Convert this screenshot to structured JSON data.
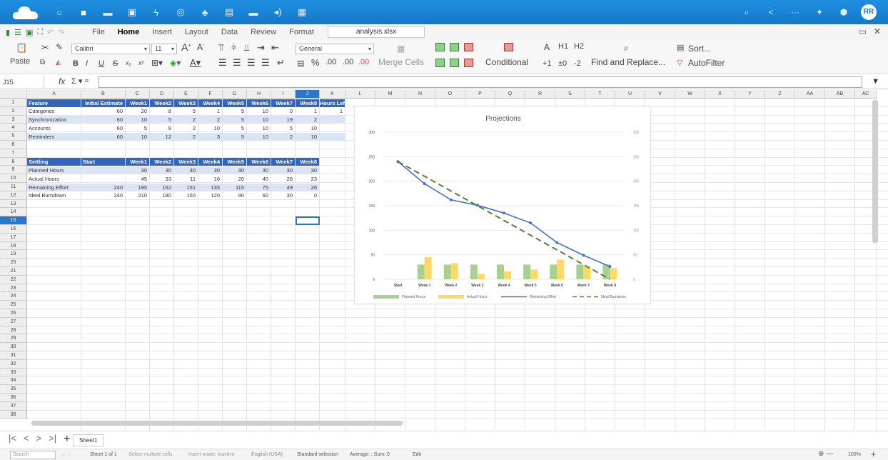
{
  "topbar": {
    "icons": [
      "circle-icon",
      "folder-icon",
      "mail-icon",
      "image-icon",
      "bolt-icon",
      "search-icon",
      "people-icon",
      "calendar-icon",
      "drive-icon",
      "audio-icon",
      "calendar2-icon"
    ],
    "icon_glyphs": [
      "○",
      "■",
      "▬",
      "▣",
      "ϟ",
      "◎",
      "♣",
      "▤",
      "▬",
      "◂)",
      "▦"
    ],
    "right_glyphs": [
      "⌕",
      "<",
      "···",
      "✦",
      "⬢"
    ],
    "avatar": "RR"
  },
  "menubar": {
    "menus": [
      "File",
      "Home",
      "Insert",
      "Layout",
      "Data",
      "Review",
      "Format"
    ],
    "active": "Home",
    "filename": "analysis.xlsx"
  },
  "ribbon": {
    "paste": "Paste",
    "font_name": "Calibri",
    "font_size": "11",
    "number_format": "General",
    "bold": "B",
    "italic": "I",
    "underline": "U",
    "strike": "S",
    "merge_cells": "Merge Cells",
    "conditional": "Conditional",
    "headings": [
      "A",
      "H1",
      "H2"
    ],
    "decimals": [
      "+1",
      "±0",
      "-2"
    ],
    "find_replace": "Find and Replace...",
    "sort": "Sort...",
    "autofilter": "AutoFilter",
    "percent": "%",
    "dec1": ".00",
    "dec2": ".00",
    "dec3": ".00"
  },
  "formula": {
    "namebox": "J15",
    "fx": "fx",
    "sum": "Σ ▾ ="
  },
  "grid": {
    "columns": [
      "A",
      "B",
      "C",
      "D",
      "E",
      "F",
      "G",
      "H",
      "I",
      "J",
      "K",
      "L",
      "M",
      "N",
      "O",
      "P",
      "Q",
      "R",
      "S",
      "T",
      "U",
      "V",
      "W",
      "X",
      "Y",
      "Z",
      "AA",
      "AB",
      "AC"
    ],
    "selected_column": "J",
    "selected_row": 15,
    "rows": [
      "1",
      "2",
      "3",
      "4",
      "5",
      "6",
      "7",
      "8",
      "9",
      "10",
      "11",
      "12",
      "13",
      "14",
      "15",
      "16",
      "17",
      "18",
      "19",
      "20",
      "21",
      "22",
      "23",
      "24",
      "25",
      "26",
      "27",
      "28",
      "29",
      "30",
      "31",
      "32",
      "33",
      "34",
      "35",
      "36",
      "37",
      "38"
    ]
  },
  "table1": {
    "header": [
      "Feature",
      "Initial Estimate",
      "Week1",
      "Week2",
      "Week3",
      "Week4",
      "Week5",
      "Week6",
      "Week7",
      "Week8",
      "Hours Left"
    ],
    "rows": [
      [
        "Categories",
        "60",
        "20",
        "8",
        "5",
        "1",
        "5",
        "10",
        "0",
        "1",
        "1"
      ],
      [
        "Synchronization",
        "60",
        "10",
        "5",
        "2",
        "2",
        "5",
        "10",
        "19",
        "2",
        ""
      ],
      [
        "Accounts",
        "60",
        "5",
        "8",
        "2",
        "10",
        "5",
        "10",
        "5",
        "10",
        ""
      ],
      [
        "Reminders",
        "60",
        "10",
        "12",
        "2",
        "3",
        "5",
        "10",
        "2",
        "10",
        ""
      ]
    ]
  },
  "table2": {
    "header": [
      "Settling",
      "Start",
      "Week1",
      "Week2",
      "Week3",
      "Week4",
      "Week5",
      "Week6",
      "Week7",
      "Week8"
    ],
    "rows": [
      [
        "Planned Hours",
        "",
        "30",
        "30",
        "30",
        "30",
        "30",
        "30",
        "30",
        "30"
      ],
      [
        "Actual Hours",
        "",
        "45",
        "33",
        "11",
        "16",
        "20",
        "40",
        "26",
        "23"
      ],
      [
        "Remaining Effort",
        "240",
        "195",
        "162",
        "151",
        "135",
        "115",
        "75",
        "49",
        "26"
      ],
      [
        "Ideal Burndown",
        "240",
        "210",
        "180",
        "150",
        "120",
        "90",
        "60",
        "30",
        "0"
      ]
    ]
  },
  "chart_data": {
    "type": "bar",
    "title": "Projections",
    "categories": [
      "Start",
      "Week 1",
      "Week 2",
      "Week 3",
      "Week 4",
      "Week 5",
      "Week 6",
      "Week 7",
      "Week 8"
    ],
    "y_ticks": [
      "0",
      "50",
      "100",
      "150",
      "200",
      "250",
      "300"
    ],
    "ylim": [
      0,
      300
    ],
    "grid": true,
    "legend_position": "bottom",
    "series": [
      {
        "name": "Planned Hours",
        "kind": "bar",
        "color": "#a9d18e",
        "values": [
          null,
          30,
          30,
          30,
          30,
          30,
          30,
          30,
          30
        ]
      },
      {
        "name": "Actual Hours",
        "kind": "bar",
        "color": "#ffd966",
        "values": [
          null,
          45,
          33,
          11,
          16,
          20,
          40,
          26,
          23
        ]
      },
      {
        "name": "Remaining Effort",
        "kind": "line",
        "color": "#4472c4",
        "values": [
          240,
          195,
          162,
          151,
          135,
          115,
          75,
          49,
          26
        ]
      },
      {
        "name": "Ideal Burndown",
        "kind": "dashed-line",
        "color": "#548235",
        "values": [
          240,
          210,
          180,
          150,
          120,
          90,
          60,
          30,
          0
        ]
      }
    ]
  },
  "sheetbar": {
    "tab": "Sheet1",
    "nav": [
      "|<",
      "<",
      ">",
      ">|",
      "+"
    ]
  },
  "status": {
    "search_placeholder": "Search",
    "sheet": "Sheet 1 of 1",
    "select_mode": "Select multiple cells",
    "insert_mode": "Insert mode: inactive",
    "language": "English (USA)",
    "selection": "Standard selection",
    "sum": "Average: ; Sum: 0",
    "edit": "Edit",
    "zoom": "100%"
  }
}
